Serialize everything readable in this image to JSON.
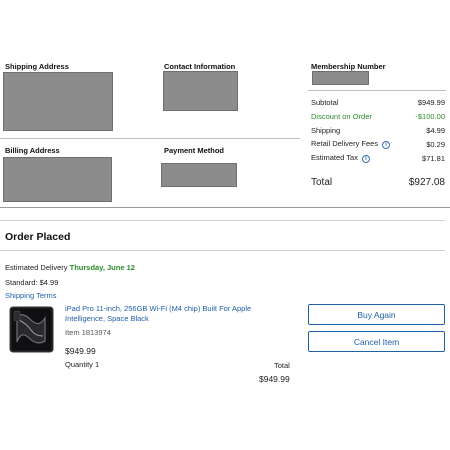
{
  "addresses": {
    "shipping_heading": "Shipping Address",
    "contact_heading": "Contact Information",
    "membership_heading": "Membership Number",
    "billing_heading": "Billing Address",
    "payment_heading": "Payment Method"
  },
  "summary": {
    "subtotal_label": "Subtotal",
    "subtotal_value": "$949.99",
    "discount_label": "Discount on Order",
    "discount_value": "-$100.00",
    "shipping_label": "Shipping",
    "shipping_value": "$4.99",
    "retail_fees_label": "Retail Delivery Fees",
    "retail_fees_value": "$0.29",
    "tax_label": "Estimated Tax",
    "tax_value": "$71.81",
    "total_label": "Total",
    "total_value": "$927.08",
    "info_glyph": "i",
    "colors": {
      "discount": "#2c8a2c",
      "link": "#1f5fa8"
    }
  },
  "order": {
    "title": "Order Placed",
    "delivery_label": "Estimated Delivery",
    "delivery_date": "Thursday, June 12",
    "standard": "Standard: $4.99",
    "shipping_terms": "Shipping Terms",
    "product_name": "iPad Pro 11-inch, 256GB Wi-Fi (M4 chip) Built For Apple Intelligence, Space Black",
    "item_number": "Item 1813974",
    "price": "$949.99",
    "quantity": "Quantity 1",
    "total_label": "Total",
    "total_value": "$949.99",
    "buy_again": "Buy Again",
    "cancel_item": "Cancel Item"
  }
}
